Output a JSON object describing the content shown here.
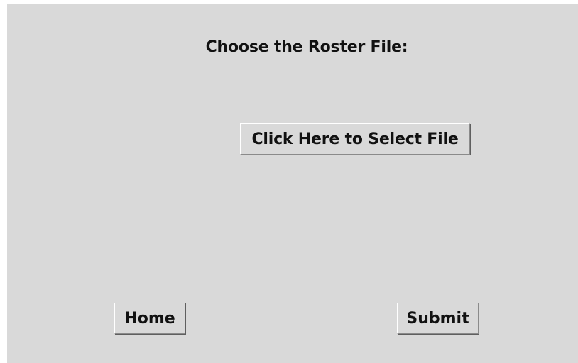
{
  "page": {
    "heading": "Choose the Roster File:",
    "select_file_label": "Click Here to Select File",
    "home_label": "Home",
    "submit_label": "Submit"
  },
  "colors": {
    "window_background": "#d9d9d9",
    "text": "#111111"
  }
}
